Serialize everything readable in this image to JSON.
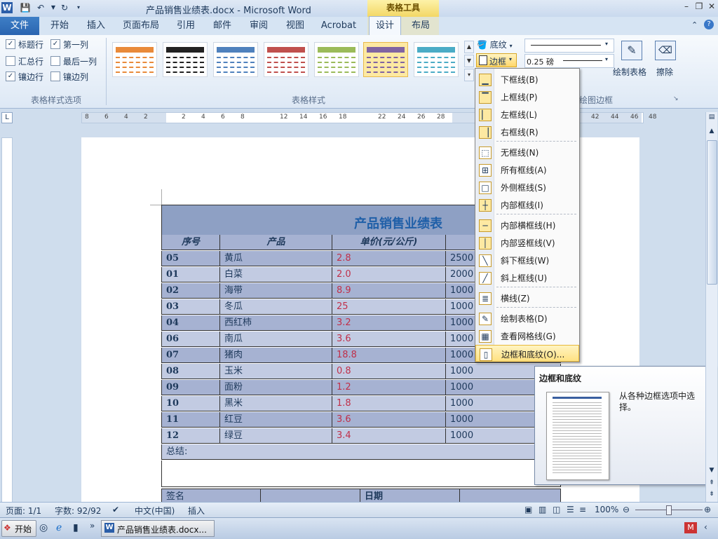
{
  "window": {
    "title": "产品销售业绩表.docx - Microsoft Word",
    "context_tab_group": "表格工具"
  },
  "tabs": [
    "文件",
    "开始",
    "插入",
    "页面布局",
    "引用",
    "邮件",
    "审阅",
    "视图",
    "Acrobat",
    "设计",
    "布局"
  ],
  "style_options": {
    "items": [
      {
        "label": "标题行",
        "checked": true
      },
      {
        "label": "第一列",
        "checked": true
      },
      {
        "label": "汇总行",
        "checked": false
      },
      {
        "label": "最后一列",
        "checked": false
      },
      {
        "label": "镶边行",
        "checked": true
      },
      {
        "label": "镶边列",
        "checked": false
      }
    ],
    "group_label": "表格样式选项"
  },
  "table_styles": {
    "group_label": "表格样式",
    "shading_label": "底纹",
    "borders_label": "边框",
    "thumb_colors": [
      "#e98a3a",
      "#222222",
      "#4f81bd",
      "#c0504d",
      "#9bbb59",
      "#8064a2",
      "#4bacc6"
    ]
  },
  "draw_borders": {
    "pen_weight": "0.25 磅",
    "draw_table": "绘制表格",
    "eraser": "擦除",
    "group_label": "绘图边框"
  },
  "ruler_h": [
    "8",
    "6",
    "4",
    "2",
    "2",
    "4",
    "6",
    "8",
    "12",
    "14",
    "16",
    "18",
    "22",
    "24",
    "26",
    "28",
    "42",
    "44",
    "46",
    "48"
  ],
  "document": {
    "title": "产品销售业绩表",
    "headers": [
      "序号",
      "产品",
      "单价(元/公斤)"
    ],
    "rows": [
      {
        "id": "05",
        "product": "黄瓜",
        "price": "2.8",
        "qty": "2500"
      },
      {
        "id": "01",
        "product": "白菜",
        "price": "2.0",
        "qty": "2000"
      },
      {
        "id": "02",
        "product": "海带",
        "price": "8.9",
        "qty": "1000"
      },
      {
        "id": "03",
        "product": "冬瓜",
        "price": "25",
        "qty": "1000"
      },
      {
        "id": "04",
        "product": "西红柿",
        "price": "3.2",
        "qty": "1000"
      },
      {
        "id": "06",
        "product": "南瓜",
        "price": "3.6",
        "qty": "1000"
      },
      {
        "id": "07",
        "product": "猪肉",
        "price": "18.8",
        "qty": "1000"
      },
      {
        "id": "08",
        "product": "玉米",
        "price": "0.8",
        "qty": "1000"
      },
      {
        "id": "09",
        "product": "面粉",
        "price": "1.2",
        "qty": "1000"
      },
      {
        "id": "10",
        "product": "黑米",
        "price": "1.8",
        "qty": "1000"
      },
      {
        "id": "11",
        "product": "红豆",
        "price": "3.6",
        "qty": "1000"
      },
      {
        "id": "12",
        "product": "绿豆",
        "price": "3.4",
        "qty": "1000"
      }
    ],
    "summary_label": "总结:",
    "sign_label": "签名",
    "date_label": "日期"
  },
  "border_menu": {
    "items": [
      {
        "label": "下框线(B)",
        "icon": "bottom-border-icon"
      },
      {
        "label": "上框线(P)",
        "icon": "top-border-icon"
      },
      {
        "label": "左框线(L)",
        "icon": "left-border-icon"
      },
      {
        "label": "右框线(R)",
        "icon": "right-border-icon"
      },
      {
        "label": "无框线(N)",
        "icon": "no-border-icon"
      },
      {
        "label": "所有框线(A)",
        "icon": "all-borders-icon"
      },
      {
        "label": "外侧框线(S)",
        "icon": "outside-borders-icon"
      },
      {
        "label": "内部框线(I)",
        "icon": "inside-borders-icon"
      },
      {
        "label": "内部横框线(H)",
        "icon": "inside-horizontal-border-icon"
      },
      {
        "label": "内部竖框线(V)",
        "icon": "inside-vertical-border-icon"
      },
      {
        "label": "斜下框线(W)",
        "icon": "diagonal-down-border-icon"
      },
      {
        "label": "斜上框线(U)",
        "icon": "diagonal-up-border-icon"
      },
      {
        "label": "横线(Z)",
        "icon": "horizontal-line-icon"
      },
      {
        "label": "绘制表格(D)",
        "icon": "draw-table-icon"
      },
      {
        "label": "查看网格线(G)",
        "icon": "view-gridlines-icon"
      },
      {
        "label": "边框和底纹(O)...",
        "icon": "borders-shading-icon"
      }
    ]
  },
  "tooltip": {
    "title": "边框和底纹",
    "description": "从各种边框选项中选择。"
  },
  "status": {
    "page": "页面: 1/1",
    "words": "字数: 92/92",
    "language": "中文(中国)",
    "mode": "插入",
    "zoom": "100%"
  },
  "taskbar": {
    "start": "开始",
    "task": "产品销售业绩表.docx..."
  }
}
